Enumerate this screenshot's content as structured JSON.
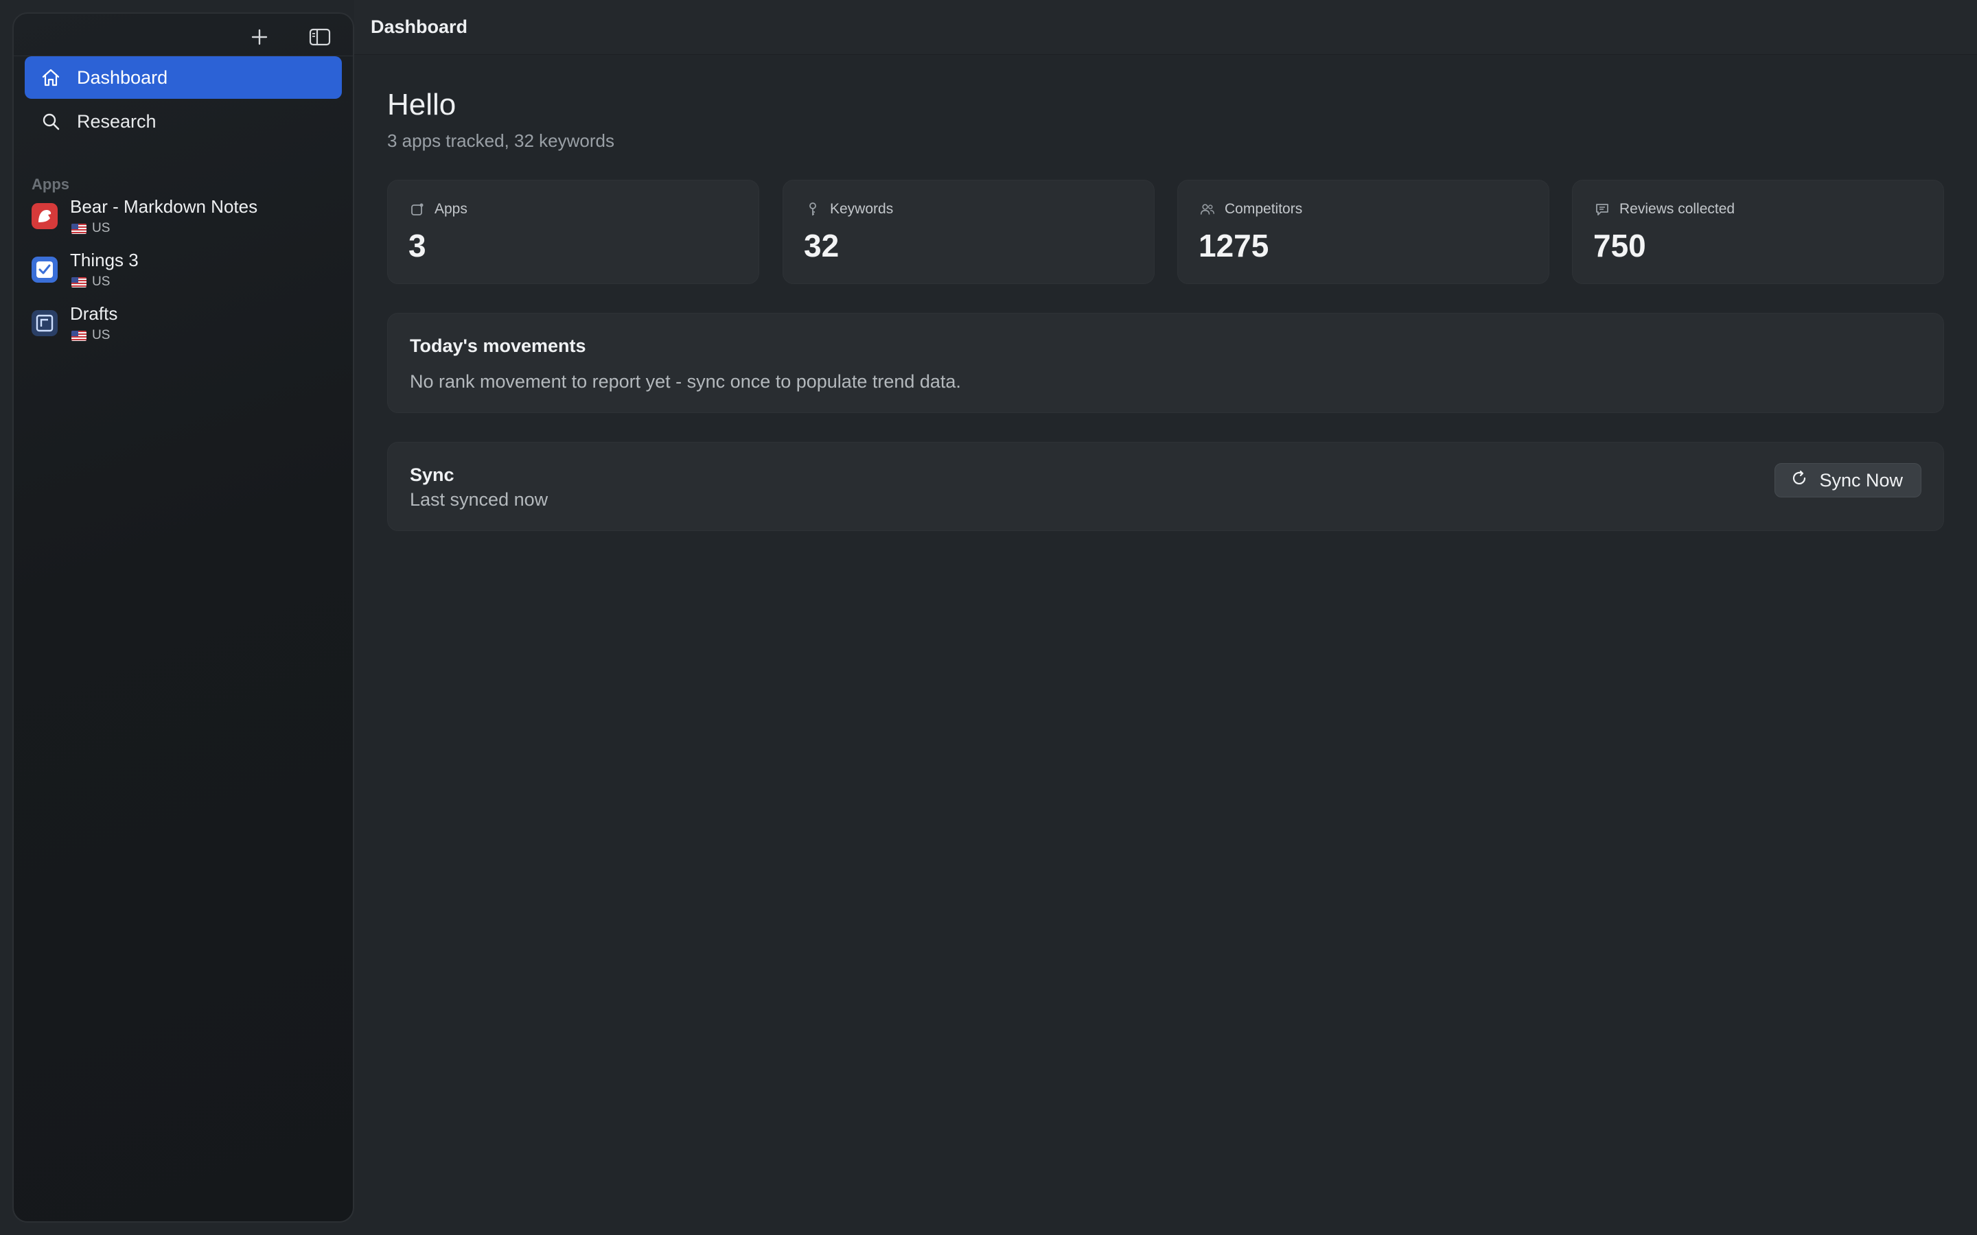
{
  "window": {
    "title": "Dashboard"
  },
  "toolbar": {
    "add_icon": "plus-icon",
    "toggle_icon": "sidebar-toggle-icon"
  },
  "sidebar": {
    "nav": [
      {
        "label": "Dashboard",
        "icon": "house-icon",
        "active": true
      },
      {
        "label": "Research",
        "icon": "magnifier-icon",
        "active": false
      }
    ],
    "apps_section_label": "Apps",
    "apps": [
      {
        "name": "Bear - Markdown Notes",
        "country": "US",
        "icon": "bear-app-icon",
        "color": "#d63a3a"
      },
      {
        "name": "Things 3",
        "country": "US",
        "icon": "things-app-icon",
        "color": "#3a6fd8"
      },
      {
        "name": "Drafts",
        "country": "US",
        "icon": "drafts-app-icon",
        "color": "#2f5fb0"
      }
    ]
  },
  "main": {
    "greeting": "Hello",
    "summary": "3 apps tracked, 32 keywords",
    "stats": [
      {
        "label": "Apps",
        "value": "3",
        "icon": "app-icon"
      },
      {
        "label": "Keywords",
        "value": "32",
        "icon": "key-icon"
      },
      {
        "label": "Competitors",
        "value": "1275",
        "icon": "people-icon"
      },
      {
        "label": "Reviews collected",
        "value": "750",
        "icon": "message-icon"
      }
    ],
    "movements": {
      "title": "Today's movements",
      "text": "No rank movement to report yet - sync once to populate trend data."
    },
    "sync": {
      "title": "Sync",
      "status": "Last synced now",
      "button_label": "Sync Now",
      "button_icon": "refresh-icon"
    }
  },
  "colors": {
    "accent": "#2c62d6",
    "background": "#22262a",
    "card": "#292d31"
  }
}
